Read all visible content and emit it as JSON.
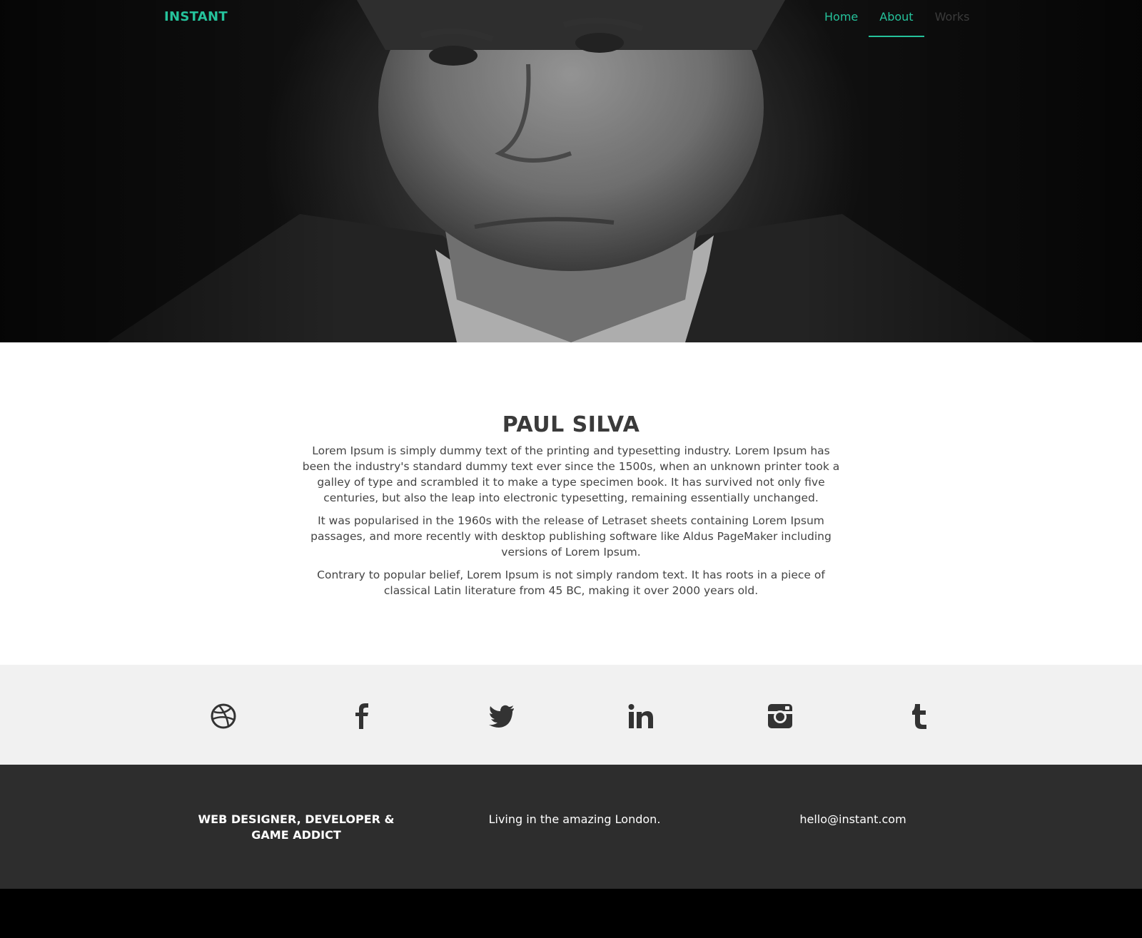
{
  "brand": "INSTANT",
  "nav": {
    "items": [
      {
        "label": "Home"
      },
      {
        "label": "About"
      },
      {
        "label": "Works"
      }
    ],
    "accent_color": "#25c29b"
  },
  "about": {
    "name": "PAUL SILVA",
    "paragraphs": [
      "Lorem Ipsum is simply dummy text of the printing and typesetting industry. Lorem Ipsum has been the industry's standard dummy text ever since the 1500s, when an unknown printer took a galley of type and scrambled it to make a type specimen book. It has survived not only five centuries, but also the leap into electronic typesetting, remaining essentially unchanged.",
      "It was popularised in the 1960s with the release of Letraset sheets containing Lorem Ipsum passages, and more recently with desktop publishing software like Aldus PageMaker including versions of Lorem Ipsum.",
      "Contrary to popular belief, Lorem Ipsum is not simply random text. It has roots in a piece of classical Latin literature from 45 BC, making it over 2000 years old."
    ]
  },
  "social": {
    "icons": [
      "dribbble-icon",
      "facebook-icon",
      "twitter-icon",
      "linkedin-icon",
      "instagram-icon",
      "tumblr-icon"
    ]
  },
  "footer": {
    "tagline": "WEB DESIGNER, DEVELOPER & GAME ADDICT",
    "location": "Living in the amazing London.",
    "email": "hello@instant.com"
  }
}
